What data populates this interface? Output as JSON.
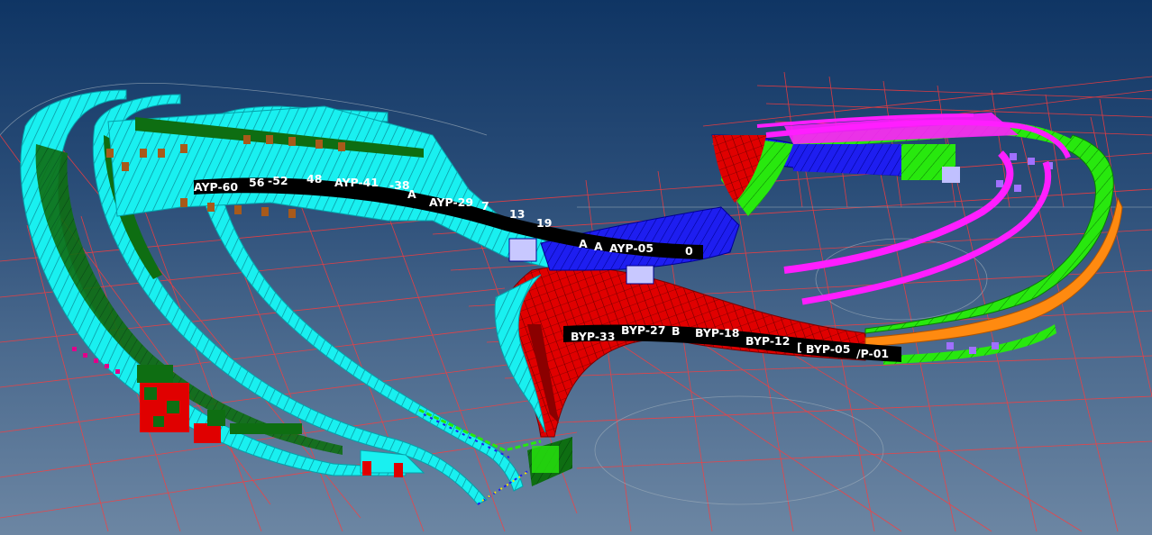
{
  "view": {
    "background_top": "#0f3564",
    "background_bottom": "#6c86a3",
    "grid_color": "#ff3b3b",
    "colors": {
      "cyan": "#19f0f0",
      "dark_green": "#0e6e12",
      "red": "#e00000",
      "blue": "#1e1ef0",
      "green": "#28e80e",
      "magenta": "#ff1eff",
      "orange": "#ff8a10"
    }
  },
  "labels_a": [
    "AYP-60",
    "56",
    "-52",
    "48",
    "AYP-41",
    "-38",
    "A",
    "AYP-29",
    "7",
    "13",
    "19",
    "A",
    "A",
    "AYP-05",
    "0"
  ],
  "labels_b": [
    "BYP-33",
    "BYP-27",
    "B",
    "BYP-18",
    "BYP-12",
    "[",
    "BYP-05",
    "/P-01"
  ]
}
